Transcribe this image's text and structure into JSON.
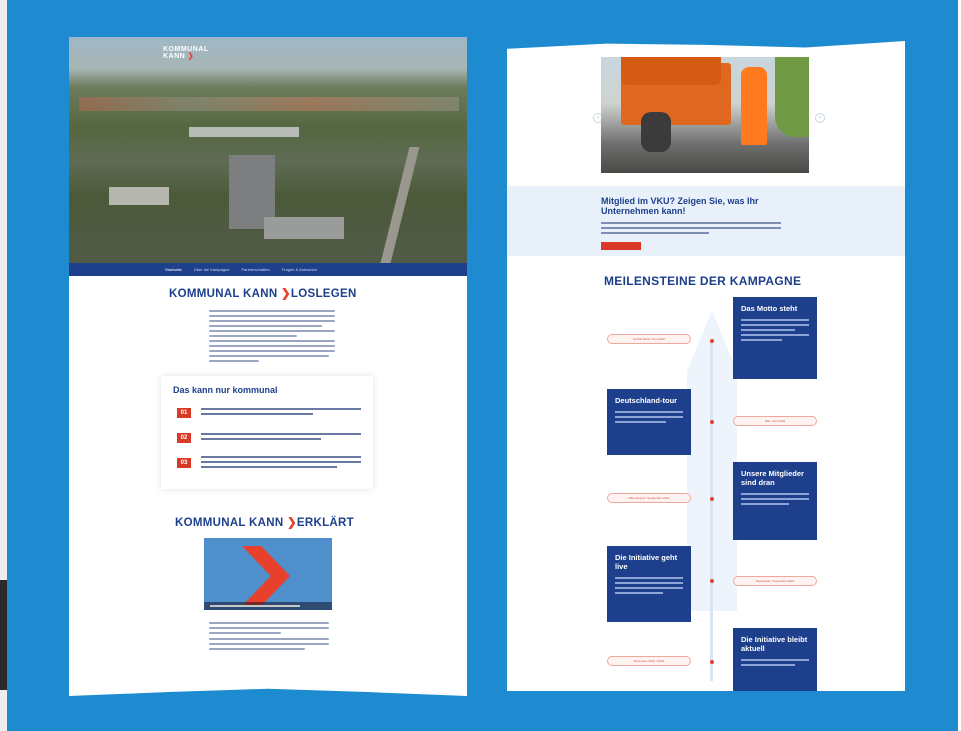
{
  "left_page": {
    "logo_line1": "KOMMUNAL",
    "logo_line2": "KANN",
    "nav": [
      "Startseite",
      "Über die Kampagne",
      "Partnerschaften",
      "Fragen & Antworten"
    ],
    "heading1_prefix": "KOMMUNAL KANN",
    "heading1_suffix": "LOSLEGEN",
    "card_title": "Das kann nur kommunal",
    "items": [
      "01",
      "02",
      "03"
    ],
    "heading2_prefix": "KOMMUNAL KANN",
    "heading2_suffix": "ERKLÄRT"
  },
  "right_page": {
    "member_title": "Mitglied im VKU? Zeigen Sie, was Ihr Unternehmen kann!",
    "milestones_title": "MEILENSTEINE DER KAMPAGNE",
    "milestones": [
      {
        "title": "Das Motto steht",
        "date": "Herbst 2021 / Juni 2022"
      },
      {
        "title": "Deutschland-tour",
        "date": "Mai / Juni 2022"
      },
      {
        "title": "Unsere Mitglieder sind dran",
        "date": "Mitte August / September 2022"
      },
      {
        "title": "Die Initiative geht live",
        "date": "September / November 2022"
      },
      {
        "title": "Die Initiative bleibt aktuell",
        "date": "Dezember 2022 / 2023"
      }
    ]
  }
}
